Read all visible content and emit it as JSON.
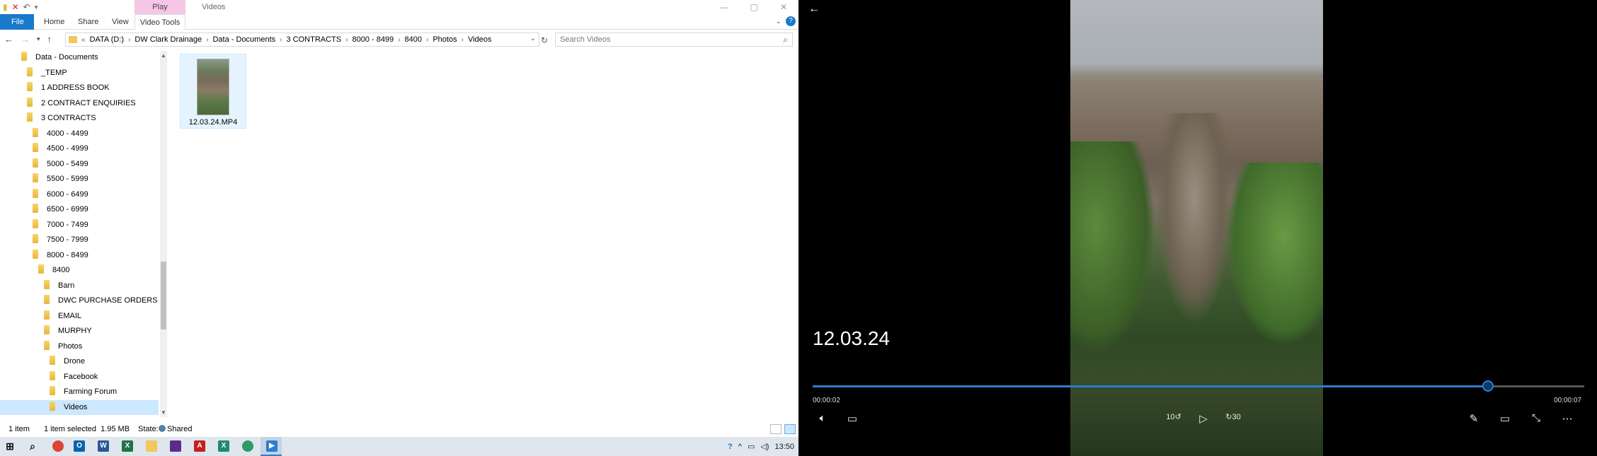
{
  "explorer": {
    "ribbon_context_tab": "Play",
    "window_title": "Videos",
    "tabs": [
      "File",
      "Home",
      "Share",
      "View",
      "Video Tools"
    ],
    "breadcrumb": [
      "DATA (D:)",
      "DW Clark Drainage",
      "Data - Documents",
      "3 CONTRACTS",
      "8000 - 8499",
      "8400",
      "Photos",
      "Videos"
    ],
    "search_placeholder": "Search Videos",
    "tree": [
      {
        "label": "Data - Documents",
        "indent": 0
      },
      {
        "label": "_TEMP",
        "indent": 1
      },
      {
        "label": "1 ADDRESS BOOK",
        "indent": 1
      },
      {
        "label": "2 CONTRACT ENQUIRIES",
        "indent": 1
      },
      {
        "label": "3 CONTRACTS",
        "indent": 1
      },
      {
        "label": "4000 - 4499",
        "indent": 2
      },
      {
        "label": "4500 - 4999",
        "indent": 2
      },
      {
        "label": "5000 - 5499",
        "indent": 2
      },
      {
        "label": "5500 - 5999",
        "indent": 2
      },
      {
        "label": "6000 - 6499",
        "indent": 2
      },
      {
        "label": "6500 - 6999",
        "indent": 2
      },
      {
        "label": "7000 - 7499",
        "indent": 2
      },
      {
        "label": "7500 - 7999",
        "indent": 2
      },
      {
        "label": "8000 - 8499",
        "indent": 2
      },
      {
        "label": "8400",
        "indent": 3
      },
      {
        "label": "Barn",
        "indent": 4
      },
      {
        "label": "DWC PURCHASE ORDERS",
        "indent": 4
      },
      {
        "label": "EMAIL",
        "indent": 4
      },
      {
        "label": "MURPHY",
        "indent": 4
      },
      {
        "label": "Photos",
        "indent": 4
      },
      {
        "label": "Drone",
        "indent": 5
      },
      {
        "label": "Facebook",
        "indent": 5
      },
      {
        "label": "Farming Forum",
        "indent": 5
      },
      {
        "label": "Videos",
        "indent": 5,
        "selected": true
      }
    ],
    "files": [
      {
        "name": "12.03.24.MP4"
      }
    ],
    "status": {
      "count": "1 item",
      "selection": "1 item selected  1.95 MB",
      "state_label": "State:",
      "state_value": "Shared"
    }
  },
  "taskbar": {
    "clock": "13:50"
  },
  "player": {
    "title": "12.03.24",
    "current_time": "00:00:02",
    "total_time": "00:00:07",
    "progress_fraction": 0.875,
    "skip_back_label": "10",
    "skip_forward_label": "30"
  }
}
